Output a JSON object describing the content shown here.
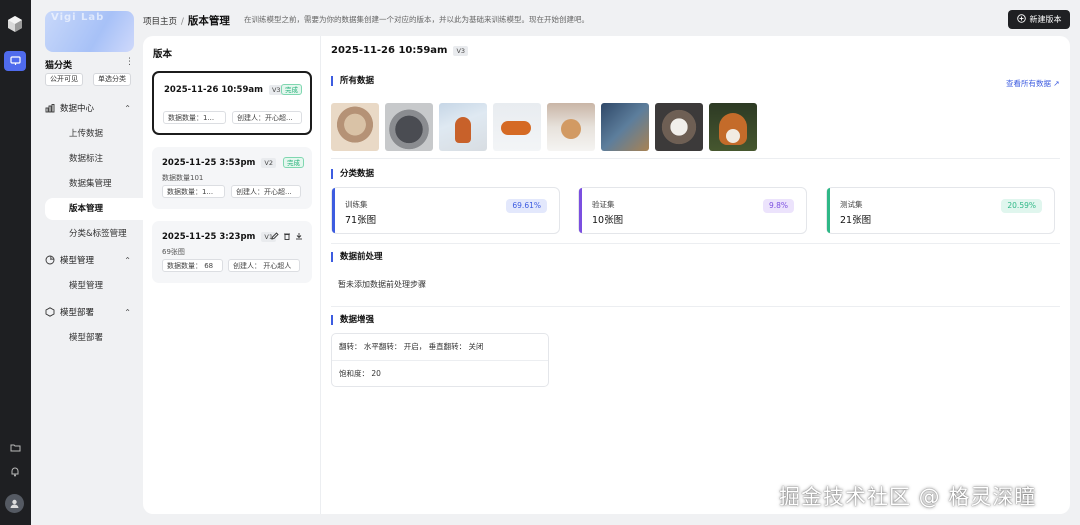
{
  "sidebar": {
    "banner_text": "Vigi Lab",
    "project_name": "猫分类",
    "more_icon": "more-icon",
    "tags": [
      "公开可见",
      "单选分类"
    ],
    "groups": [
      {
        "label": "数据中心",
        "icon": "chart-icon",
        "items": [
          "上传数据",
          "数据标注",
          "数据集管理",
          "版本管理",
          "分类&标签管理"
        ]
      },
      {
        "label": "模型管理",
        "icon": "cube-icon",
        "items": [
          "模型管理"
        ]
      },
      {
        "label": "模型部署",
        "icon": "hexagon-icon",
        "items": [
          "模型部署"
        ]
      }
    ],
    "active_item": "版本管理"
  },
  "header": {
    "breadcrumb_home": "项目主页",
    "breadcrumb_sep": "/",
    "breadcrumb_current": "版本管理",
    "hint": "在训练模型之前，需要为你的数据集创建一个对应的版本，并以此为基础来训练模型。现在开始创建吧。",
    "new_version_label": "新建版本"
  },
  "versions": {
    "heading": "版本",
    "list": [
      {
        "datetime": "2025-11-26 10:59am",
        "tag": "V3",
        "status": "完成",
        "count_label": "数据数量：1...",
        "creator_label": "创建人：开心超..."
      },
      {
        "datetime": "2025-11-25 3:53pm",
        "tag": "V2",
        "status": "完成",
        "sub": "数据数量101",
        "count_label": "数据数量：1...",
        "creator_label": "创建人：开心超..."
      },
      {
        "datetime": "2025-11-25 3:23pm",
        "tag": "V1",
        "sub": "69张图",
        "count_label": "数据数量： 68",
        "creator_label": "创建人： 开心超人"
      }
    ]
  },
  "detail": {
    "title": "2025-11-26 10:59am",
    "tag": "V3",
    "all_data_heading": "所有数据",
    "view_all": "查看所有数据 ↗",
    "split_heading": "分类数据",
    "splits": [
      {
        "name": "训练集",
        "count": "71张图",
        "percent": "69.61%",
        "color": "#3d5ce0",
        "badge_bg": "#e3e8fc",
        "badge_fg": "#3d5ce0"
      },
      {
        "name": "验证集",
        "count": "10张图",
        "percent": "9.8%",
        "color": "#7b4fe0",
        "badge_bg": "#ece3fc",
        "badge_fg": "#7b4fe0"
      },
      {
        "name": "测试集",
        "count": "21张图",
        "percent": "20.59%",
        "color": "#2fb887",
        "badge_bg": "#e0f6ee",
        "badge_fg": "#2fb887"
      }
    ],
    "preprocess_heading": "数据前处理",
    "preprocess_empty": "暂未添加数据前处理步骤",
    "augment_heading": "数据增强",
    "augment_rows": [
      "翻转： 水平翻转： 开启， 垂直翻转： 关闭",
      "饱和度： 20"
    ]
  },
  "watermark": "掘金技术社区 @ 格灵深瞳"
}
